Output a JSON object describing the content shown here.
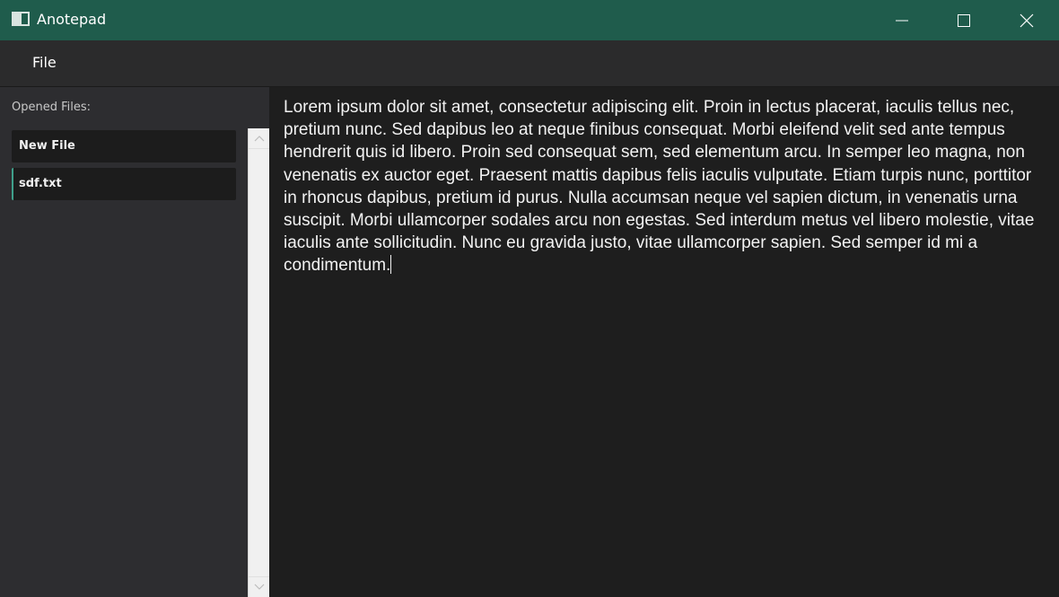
{
  "window": {
    "title": "Anotepad",
    "controls": {
      "minimize_icon": "minimize-icon",
      "maximize_icon": "maximize-icon",
      "close_icon": "close-icon"
    }
  },
  "menubar": {
    "items": [
      {
        "label": "File"
      }
    ]
  },
  "sidebar": {
    "heading": "Opened Files:",
    "files": [
      {
        "label": "New File",
        "selected": false
      },
      {
        "label": "sdf.txt",
        "selected": true
      }
    ]
  },
  "editor": {
    "content": "Lorem ipsum dolor sit amet, consectetur adipiscing elit. Proin in lectus placerat, iaculis tellus nec, pretium nunc. Sed dapibus leo at neque finibus consequat. Morbi eleifend velit sed ante tempus hendrerit quis id libero. Proin sed consequat sem, sed elementum arcu. In semper leo magna, non venenatis ex auctor eget. Praesent mattis dapibus felis iaculis vulputate. Etiam turpis nunc, porttitor in rhoncus dapibus, pretium id purus. Nulla accumsan neque vel sapien dictum, in venenatis urna suscipit. Morbi ullamcorper sodales arcu non egestas. Sed interdum metus vel libero molestie, vitae iaculis ante sollicitudin. Nunc eu gravida justo, vitae ullamcorper sapien. Sed semper id mi a condimentum."
  },
  "colors": {
    "titlebar": "#1f5c4c",
    "menubar": "#2b2b2c",
    "sidebar": "#2d2d30",
    "editor": "#1e1e1e",
    "accent": "#3fa08a"
  }
}
